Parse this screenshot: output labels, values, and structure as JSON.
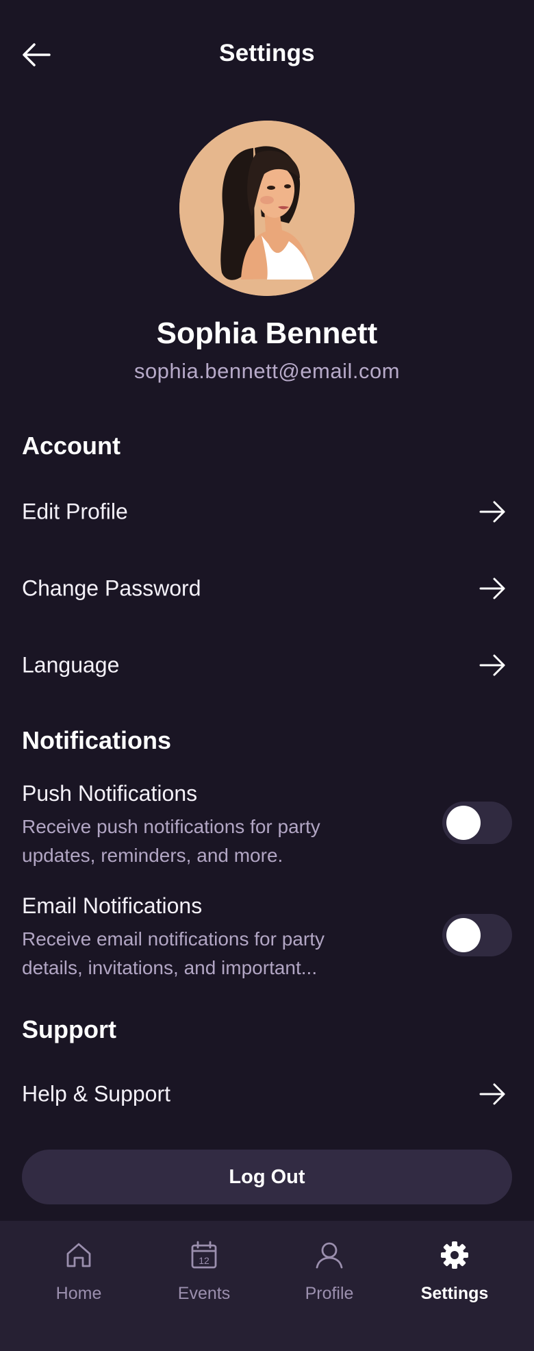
{
  "header": {
    "title": "Settings"
  },
  "profile": {
    "name": "Sophia Bennett",
    "email": "sophia.bennett@email.com"
  },
  "account": {
    "title": "Account",
    "items": [
      {
        "label": "Edit Profile"
      },
      {
        "label": "Change Password"
      },
      {
        "label": "Language"
      }
    ]
  },
  "notifications": {
    "title": "Notifications",
    "items": [
      {
        "title": "Push Notifications",
        "description": "Receive push notifications for party updates, reminders, and more.",
        "enabled": false
      },
      {
        "title": "Email Notifications",
        "description": "Receive email notifications for party details, invitations, and important...",
        "enabled": false
      }
    ]
  },
  "support": {
    "title": "Support",
    "items": [
      {
        "label": "Help & Support"
      }
    ]
  },
  "logout": {
    "label": "Log Out"
  },
  "nav": {
    "items": [
      {
        "label": "Home",
        "icon": "home-icon",
        "active": false
      },
      {
        "label": "Events",
        "icon": "calendar-icon",
        "calendar_day": "12",
        "active": false
      },
      {
        "label": "Profile",
        "icon": "user-icon",
        "active": false
      },
      {
        "label": "Settings",
        "icon": "gear-icon",
        "active": true
      }
    ]
  },
  "colors": {
    "background": "#1a1524",
    "surface": "#322b43",
    "nav_background": "#262033",
    "muted_text": "#b2a6c4",
    "inactive_nav": "#9b8fae",
    "avatar_background": "#e8b98f"
  }
}
